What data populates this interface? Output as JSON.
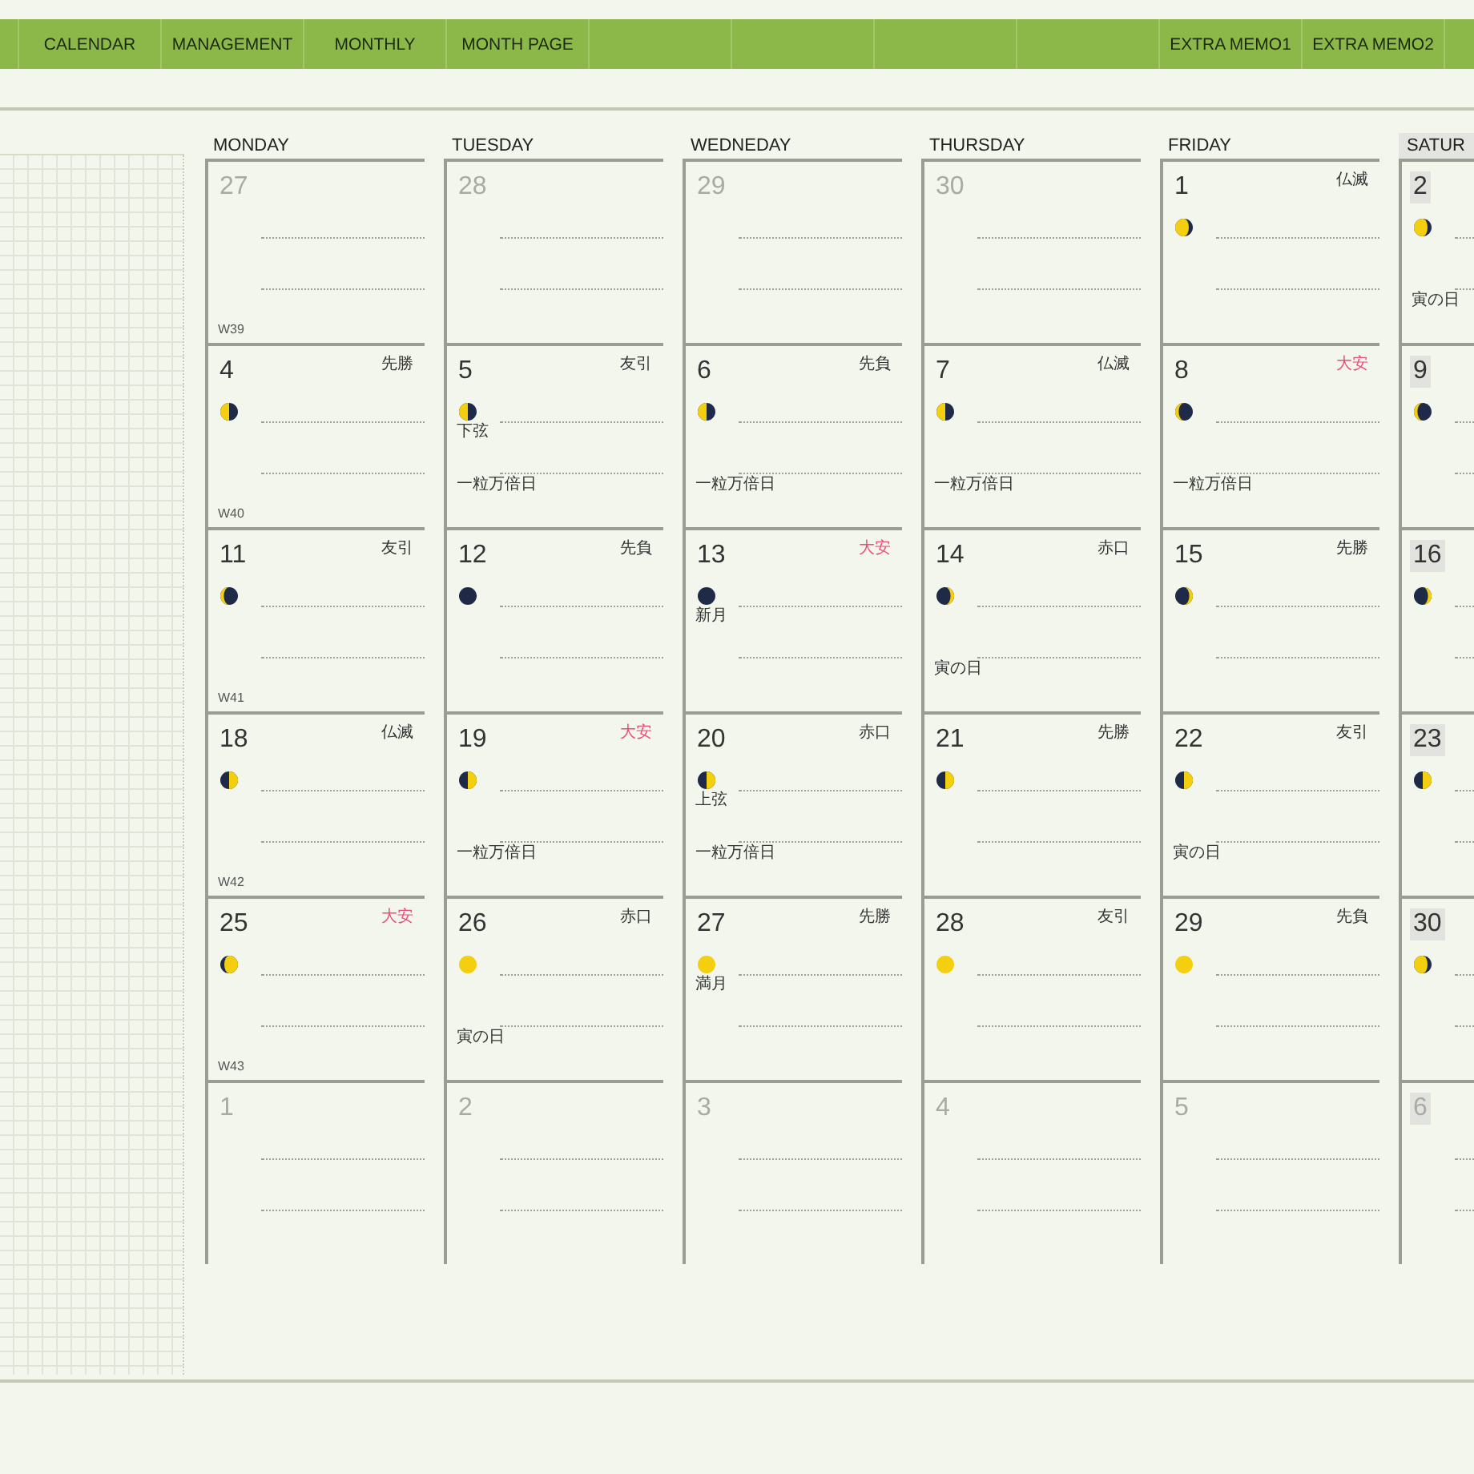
{
  "nav": {
    "left_tabs": [
      "CALENDAR",
      "MANAGEMENT",
      "MONTHLY",
      "MONTH PAGE"
    ],
    "right_tabs": [
      "EXTRA MEMO1",
      "EXTRA MEMO2"
    ]
  },
  "weekdays": [
    {
      "label": "MONDAY",
      "weekend": false
    },
    {
      "label": "TUESDAY",
      "weekend": false
    },
    {
      "label": "WEDNEDAY",
      "weekend": false
    },
    {
      "label": "THURSDAY",
      "weekend": false
    },
    {
      "label": "FRIDAY",
      "weekend": false
    },
    {
      "label": "SATUR",
      "weekend": true
    }
  ],
  "weeks": [
    {
      "days": [
        {
          "day": "27",
          "muted": true,
          "week": "W39"
        },
        {
          "day": "28",
          "muted": true
        },
        {
          "day": "29",
          "muted": true
        },
        {
          "day": "30",
          "muted": true
        },
        {
          "day": "1",
          "muted": false,
          "rokuyo": {
            "text": "仏滅",
            "color": "#333333"
          },
          "moon": {
            "kind": "waning-gibbous"
          }
        },
        {
          "day": "2",
          "muted": false,
          "moon": {
            "kind": "waning-gibbous"
          },
          "note": "寅の日"
        }
      ]
    },
    {
      "days": [
        {
          "day": "4",
          "muted": false,
          "rokuyo": {
            "text": "先勝",
            "color": "#333333"
          },
          "moon": {
            "kind": "last-quarter"
          },
          "week": "W40"
        },
        {
          "day": "5",
          "muted": false,
          "rokuyo": {
            "text": "友引",
            "color": "#333333"
          },
          "moon": {
            "kind": "last-quarter"
          },
          "phase_note": "下弦",
          "note": "一粒万倍日"
        },
        {
          "day": "6",
          "muted": false,
          "rokuyo": {
            "text": "先負",
            "color": "#333333"
          },
          "moon": {
            "kind": "last-quarter"
          },
          "note": "一粒万倍日"
        },
        {
          "day": "7",
          "muted": false,
          "rokuyo": {
            "text": "仏滅",
            "color": "#333333"
          },
          "moon": {
            "kind": "last-quarter"
          },
          "note": "一粒万倍日"
        },
        {
          "day": "8",
          "muted": false,
          "rokuyo": {
            "text": "大安",
            "color": "#e8507a"
          },
          "moon": {
            "kind": "waning-crescent"
          },
          "note": "一粒万倍日"
        },
        {
          "day": "9",
          "muted": false,
          "moon": {
            "kind": "waning-crescent"
          }
        }
      ]
    },
    {
      "days": [
        {
          "day": "11",
          "muted": false,
          "rokuyo": {
            "text": "友引",
            "color": "#333333"
          },
          "moon": {
            "kind": "waning-crescent"
          },
          "week": "W41"
        },
        {
          "day": "12",
          "muted": false,
          "rokuyo": {
            "text": "先負",
            "color": "#333333"
          },
          "moon": {
            "kind": "new"
          }
        },
        {
          "day": "13",
          "muted": false,
          "rokuyo": {
            "text": "大安",
            "color": "#e8507a"
          },
          "moon": {
            "kind": "new"
          },
          "phase_note": "新月"
        },
        {
          "day": "14",
          "muted": false,
          "rokuyo": {
            "text": "赤口",
            "color": "#333333"
          },
          "moon": {
            "kind": "waxing-crescent"
          },
          "note": "寅の日"
        },
        {
          "day": "15",
          "muted": false,
          "rokuyo": {
            "text": "先勝",
            "color": "#333333"
          },
          "moon": {
            "kind": "waxing-crescent"
          }
        },
        {
          "day": "16",
          "muted": false,
          "moon": {
            "kind": "waxing-crescent"
          }
        }
      ]
    },
    {
      "days": [
        {
          "day": "18",
          "muted": false,
          "rokuyo": {
            "text": "仏滅",
            "color": "#333333"
          },
          "moon": {
            "kind": "first-quarter"
          },
          "week": "W42"
        },
        {
          "day": "19",
          "muted": false,
          "rokuyo": {
            "text": "大安",
            "color": "#e8507a"
          },
          "moon": {
            "kind": "first-quarter"
          },
          "note": "一粒万倍日"
        },
        {
          "day": "20",
          "muted": false,
          "rokuyo": {
            "text": "赤口",
            "color": "#333333"
          },
          "moon": {
            "kind": "first-quarter"
          },
          "phase_note": "上弦",
          "note": "一粒万倍日"
        },
        {
          "day": "21",
          "muted": false,
          "rokuyo": {
            "text": "先勝",
            "color": "#333333"
          },
          "moon": {
            "kind": "first-quarter"
          }
        },
        {
          "day": "22",
          "muted": false,
          "rokuyo": {
            "text": "友引",
            "color": "#333333"
          },
          "moon": {
            "kind": "first-quarter"
          },
          "note": "寅の日"
        },
        {
          "day": "23",
          "muted": false,
          "moon": {
            "kind": "first-quarter"
          }
        }
      ]
    },
    {
      "days": [
        {
          "day": "25",
          "muted": false,
          "rokuyo": {
            "text": "大安",
            "color": "#e8507a"
          },
          "moon": {
            "kind": "waxing-gibbous"
          },
          "week": "W43"
        },
        {
          "day": "26",
          "muted": false,
          "rokuyo": {
            "text": "赤口",
            "color": "#333333"
          },
          "moon": {
            "kind": "full"
          },
          "note": "寅の日"
        },
        {
          "day": "27",
          "muted": false,
          "rokuyo": {
            "text": "先勝",
            "color": "#333333"
          },
          "moon": {
            "kind": "full"
          },
          "phase_note": "満月"
        },
        {
          "day": "28",
          "muted": false,
          "rokuyo": {
            "text": "友引",
            "color": "#333333"
          },
          "moon": {
            "kind": "full"
          }
        },
        {
          "day": "29",
          "muted": false,
          "rokuyo": {
            "text": "先負",
            "color": "#333333"
          },
          "moon": {
            "kind": "full"
          }
        },
        {
          "day": "30",
          "muted": false,
          "moon": {
            "kind": "waning-gibbous"
          }
        }
      ]
    },
    {
      "days": [
        {
          "day": "1",
          "muted": true
        },
        {
          "day": "2",
          "muted": true
        },
        {
          "day": "3",
          "muted": true
        },
        {
          "day": "4",
          "muted": true
        },
        {
          "day": "5",
          "muted": true
        },
        {
          "day": "6",
          "muted": true
        }
      ]
    }
  ]
}
